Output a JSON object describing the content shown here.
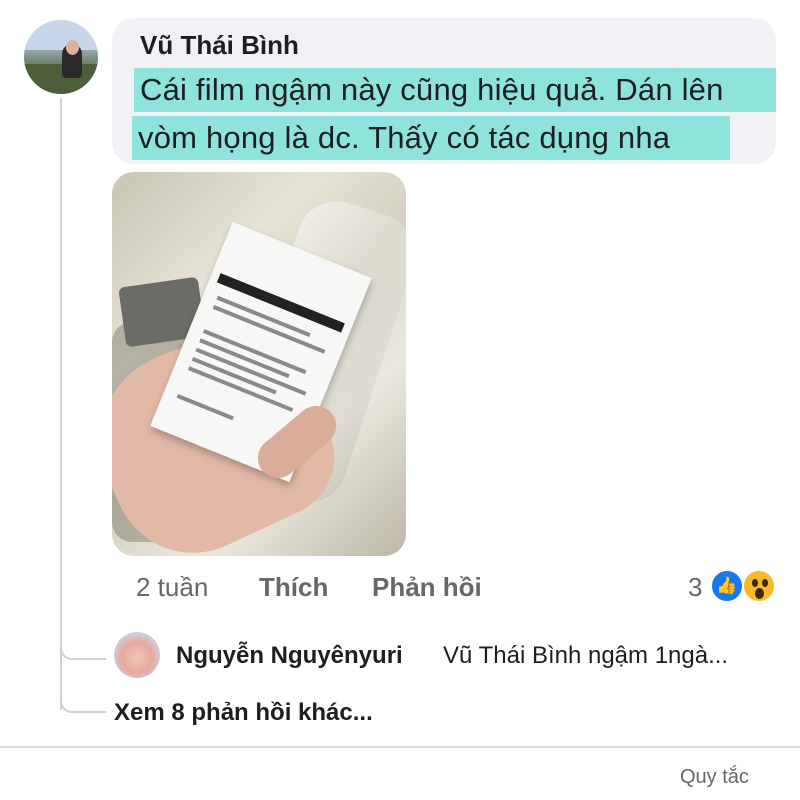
{
  "comment": {
    "author": "Vũ Thái Bình",
    "text_line1": "Cái film ngậm này cũng hiệu quả. Dán lên",
    "text_line2": "vòm họng là dc. Thấy có tác dụng nha",
    "highlight_color": "#8fe3dd"
  },
  "actions": {
    "time": "2 tuần",
    "like": "Thích",
    "reply": "Phản hồi",
    "reaction_count": "3",
    "reactions": [
      "like-icon",
      "wow-icon"
    ]
  },
  "reply": {
    "author": "Nguyễn Nguyênyuri",
    "text": "Vũ Thái Bình ngậm 1ngà..."
  },
  "more_replies": "Xem 8 phản hồi khác...",
  "footer": {
    "link": "Quy tắc"
  },
  "colors": {
    "bubble": "#f0f2f5",
    "secondary_text": "#65676b",
    "like_blue": "#1877f2",
    "wow_yellow": "#f7b928"
  }
}
